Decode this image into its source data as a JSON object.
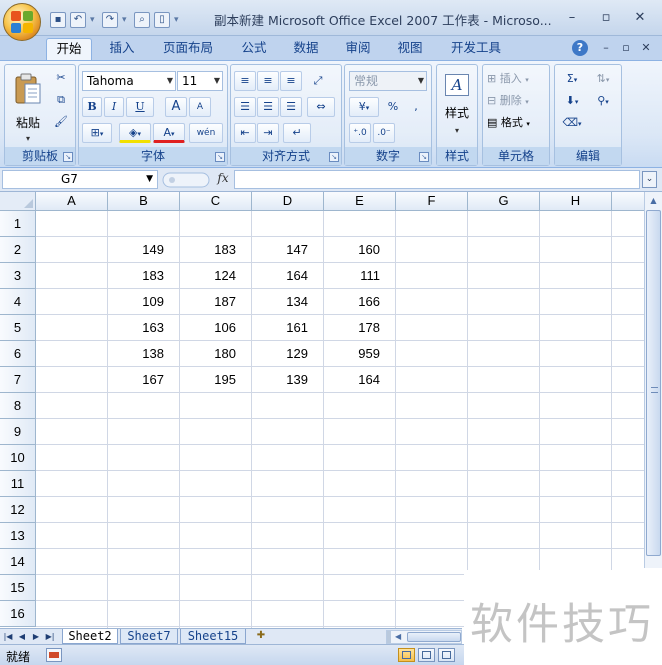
{
  "window": {
    "title": "副本新建 Microsoft Office Excel 2007 工作表 - Microso...",
    "minimize_glyph": "–",
    "restore_glyph": "▫",
    "close_glyph": "✕"
  },
  "quick_access": {
    "icons": [
      "save-icon",
      "undo-icon",
      "redo-icon",
      "print-preview-icon",
      "new-document-icon",
      "customize-qat-icon"
    ]
  },
  "tabs": [
    {
      "label": "开始",
      "active": true
    },
    {
      "label": "插入",
      "active": false
    },
    {
      "label": "页面布局",
      "active": false
    },
    {
      "label": "公式",
      "active": false
    },
    {
      "label": "数据",
      "active": false
    },
    {
      "label": "审阅",
      "active": false
    },
    {
      "label": "视图",
      "active": false
    },
    {
      "label": "开发工具",
      "active": false
    }
  ],
  "ribbon": {
    "clipboard": {
      "label": "剪贴板",
      "paste_label": "粘贴"
    },
    "font": {
      "label": "字体",
      "font_name": "Tahoma",
      "font_size": "11",
      "bold": "B",
      "italic": "I",
      "underline": "U",
      "grow": "A",
      "shrink": "A",
      "font_color": "A",
      "pinyin": "wén"
    },
    "alignment": {
      "label": "对齐方式"
    },
    "number": {
      "label": "数字",
      "format": "常规",
      "percent": "%",
      "comma": ","
    },
    "styles": {
      "label": "样式"
    },
    "cells": {
      "label": "单元格",
      "insert": "插入",
      "delete": "删除",
      "format": "格式"
    },
    "editing": {
      "label": "编辑",
      "sum": "Σ"
    }
  },
  "formula_bar": {
    "name_box": "G7",
    "fx": "fx",
    "formula": ""
  },
  "grid": {
    "columns": [
      "A",
      "B",
      "C",
      "D",
      "E",
      "F",
      "G",
      "H"
    ],
    "rows": [
      "1",
      "2",
      "3",
      "4",
      "5",
      "6",
      "7",
      "8",
      "9",
      "10",
      "11",
      "12",
      "13",
      "14",
      "15",
      "16"
    ],
    "data": [
      [
        "149",
        "183",
        "147",
        "160"
      ],
      [
        "183",
        "124",
        "164",
        "111"
      ],
      [
        "109",
        "187",
        "134",
        "166"
      ],
      [
        "163",
        "106",
        "161",
        "178"
      ],
      [
        "138",
        "180",
        "129",
        "959"
      ],
      [
        "167",
        "195",
        "139",
        "164"
      ]
    ]
  },
  "sheets": [
    {
      "name": "Sheet2",
      "active": true
    },
    {
      "name": "Sheet7",
      "active": false
    },
    {
      "name": "Sheet15",
      "active": false
    }
  ],
  "status": {
    "text": "就绪"
  },
  "watermark": "软件技巧"
}
